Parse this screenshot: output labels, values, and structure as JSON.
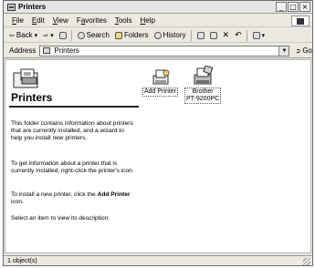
{
  "window": {
    "title": "Printers"
  },
  "title_buttons": [
    "_",
    "□",
    "×"
  ],
  "menu": {
    "items": [
      {
        "label": "File",
        "u": "F",
        "rest": "ile"
      },
      {
        "label": "Edit",
        "u": "E",
        "rest": "dit"
      },
      {
        "label": "View",
        "u": "V",
        "rest": "iew"
      },
      {
        "label": "Favorites",
        "pre": "F",
        "u": "a",
        "rest": "vorites"
      },
      {
        "label": "Tools",
        "u": "T",
        "rest": "ools"
      },
      {
        "label": "Help",
        "u": "H",
        "rest": "elp"
      }
    ]
  },
  "toolbar": {
    "back": "Back",
    "search": "Search",
    "folders": "Folders",
    "history": "History"
  },
  "address": {
    "label": "Address",
    "value": "Printers",
    "go": "Go"
  },
  "folder": {
    "title": "Printers",
    "p1": "This folder contains information about printers that are currently installed, and a wizard to help you install new printers.",
    "p2": "To get information about a printer that is currently installed, right-click the printer's icon.",
    "p3_pre": "To install a new printer, click the ",
    "p3_bold": "Add Printer",
    "p3_post": " icon.",
    "p4": "Select an item to view its description."
  },
  "items": [
    {
      "label": "Add Printer",
      "icon": "add-printer-icon"
    },
    {
      "label_line1": "Brother",
      "label_line2": "PT-9200PC",
      "icon": "printer-icon"
    }
  ],
  "status": {
    "text": "1 object(s)"
  }
}
